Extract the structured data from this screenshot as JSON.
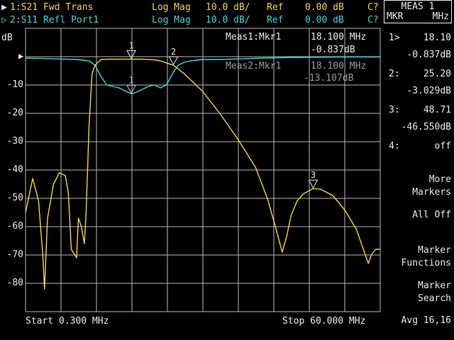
{
  "colors": {
    "trace1": "#f4d23c",
    "trace2": "#3cd6dc",
    "grid": "#b8b8b8",
    "text": "#e8e8e8",
    "background": "#000000"
  },
  "header": {
    "trace1": {
      "marker": "▶",
      "label": "1:S21 Fwd Trans",
      "format": "Log Mag",
      "scale": "10.0 dB/",
      "ref_label": "Ref",
      "ref_value": "0.00 dB",
      "cal": "C?"
    },
    "trace2": {
      "marker": "▷",
      "label": "2:S11 Refl Port1",
      "format": "Log Mag",
      "scale": "10.0 dB/",
      "ref_label": "Ref",
      "ref_value": "0.00 dB",
      "cal": "C?"
    }
  },
  "plot": {
    "unit": "dB",
    "ref_arrow": "▶",
    "y_ticks": [
      "-10",
      "-20",
      "-30",
      "-40",
      "-50",
      "-60",
      "-70",
      "-80"
    ],
    "start_label": "Start 0.300 MHz",
    "stop_label": "Stop 60.000 MHz",
    "meas1": {
      "label": "Meas1:Mkr1",
      "freq": "18.100 MHz",
      "value": "-0.837dB"
    },
    "meas2": {
      "label": "Meas2:Mkr1",
      "freq": "18.100 MHz",
      "value": "-13.107dB"
    }
  },
  "chart_data": {
    "type": "line",
    "xlabel": "",
    "ylabel": "dB",
    "xlim": [
      0.3,
      60.0
    ],
    "ylim": [
      -90,
      10
    ],
    "grid": true,
    "series": [
      {
        "name": "1:S21 Fwd Trans",
        "x": [
          0.3,
          0.8,
          1.5,
          2.5,
          3.2,
          3.5,
          4.0,
          5.0,
          6.0,
          7.0,
          7.5,
          8.0,
          8.9,
          9.2,
          9.7,
          10.2,
          10.5,
          11.0,
          11.5,
          12.0,
          13.0,
          14.0,
          15.0,
          18.1,
          20.0,
          22.0,
          23.0,
          24.0,
          25.2,
          27.0,
          30.0,
          33.0,
          36.0,
          39.0,
          41.0,
          42.5,
          43.5,
          44.3,
          45.0,
          46.0,
          47.0,
          48.71,
          50.0,
          52.0,
          54.0,
          56.0,
          57.5,
          58.0,
          58.5,
          59.2,
          60.0
        ],
        "y": [
          -55,
          -50,
          -43,
          -51,
          -70,
          -82,
          -57,
          -45,
          -41,
          -42,
          -48,
          -68,
          -71,
          -57,
          -60,
          -66,
          -55,
          -24,
          -6,
          -3,
          -1,
          -0.9,
          -0.9,
          -0.84,
          -0.9,
          -1.1,
          -1.5,
          -2.2,
          -3.03,
          -6,
          -12,
          -20,
          -29,
          -39,
          -50,
          -61,
          -69,
          -63,
          -56,
          -51,
          -48.5,
          -46.55,
          -46.8,
          -49,
          -54,
          -61,
          -70,
          -73,
          -70,
          -68,
          -68
        ]
      },
      {
        "name": "2:S11 Refl Port1",
        "x": [
          0.3,
          3.0,
          6.0,
          9.0,
          11.0,
          12.0,
          13.0,
          14.0,
          15.0,
          16.0,
          17.0,
          18.1,
          19.0,
          20.0,
          21.0,
          22.0,
          23.0,
          24.0,
          25.2,
          26.0,
          27.0,
          28.0,
          30.0,
          33.0,
          36.0,
          40.0,
          45.0,
          50.0,
          55.0,
          60.0
        ],
        "y": [
          -0.5,
          -0.6,
          -0.8,
          -1.0,
          -1.5,
          -3,
          -7,
          -10,
          -10.5,
          -11,
          -12,
          -13.1,
          -12.5,
          -11.5,
          -10.5,
          -10,
          -11,
          -10,
          -5.5,
          -3,
          -2,
          -1.5,
          -1.0,
          -1.0,
          -0.8,
          -0.5,
          -0.3,
          -0.2,
          -0.1,
          -0.1
        ]
      }
    ],
    "markers": [
      {
        "id": "1",
        "freq_mhz": 18.1,
        "s21_db": -0.837,
        "s11_db": -13.107
      },
      {
        "id": "2",
        "freq_mhz": 25.2,
        "s21_db": -3.029
      },
      {
        "id": "3",
        "freq_mhz": 48.71,
        "s21_db": -46.55
      }
    ]
  },
  "marker_panel": {
    "title": "MEAS 1",
    "col1": "MKR",
    "col2": "MHz",
    "rows": [
      {
        "label": "1>",
        "freq": "18.10",
        "amp": "-0.837dB"
      },
      {
        "label": "2:",
        "freq": "25.20",
        "amp": "-3.029dB"
      },
      {
        "label": "3:",
        "freq": "48.71",
        "amp": "-46.550dB"
      },
      {
        "label": "4:",
        "freq": "off",
        "amp": ""
      }
    ]
  },
  "softkeys": {
    "more_markers": "More\nMarkers",
    "all_off": "All Off",
    "marker_functions": "Marker\nFunctions",
    "marker_search": "Marker\nSearch",
    "avg": "Avg 16,16"
  }
}
